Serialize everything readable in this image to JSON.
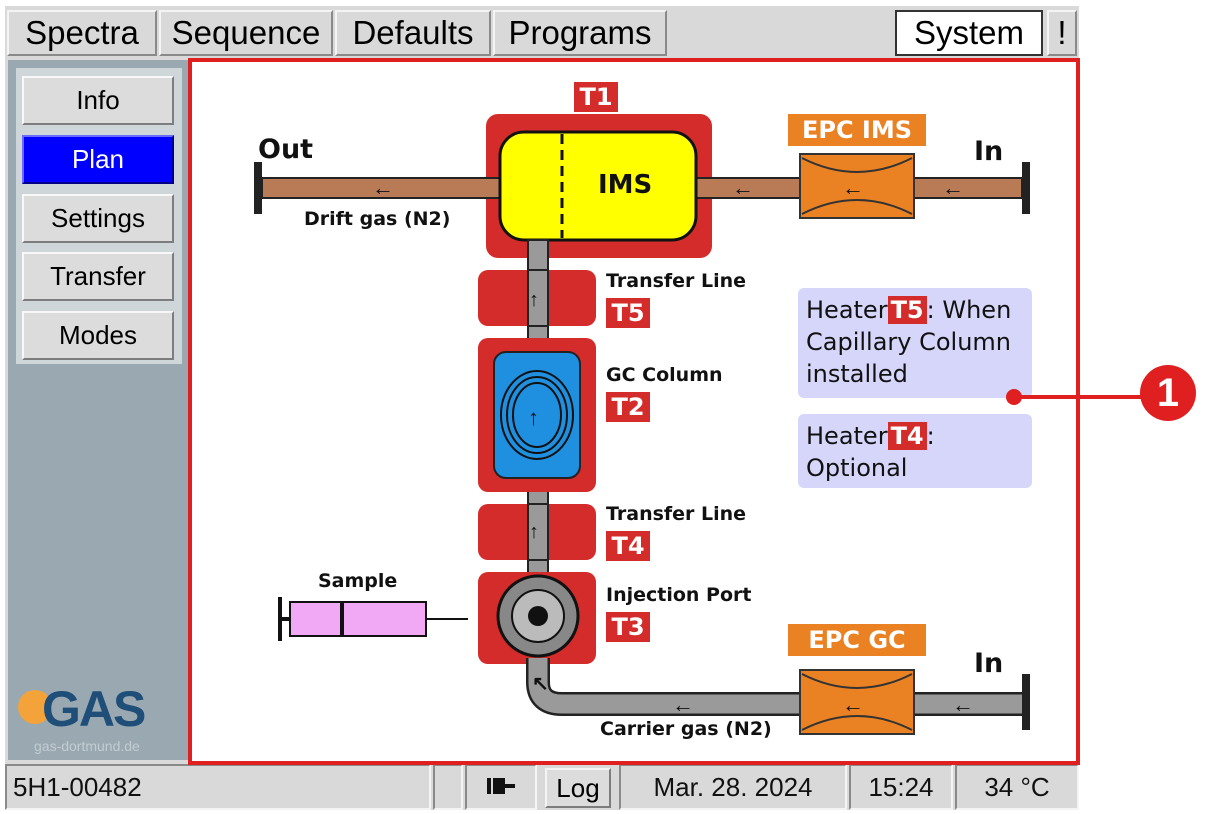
{
  "tabs": [
    {
      "label": "Spectra"
    },
    {
      "label": "Sequence"
    },
    {
      "label": "Defaults"
    },
    {
      "label": "Programs"
    }
  ],
  "system_label": "System",
  "alert_label": "!",
  "sidebar": {
    "items": [
      {
        "label": "Info"
      },
      {
        "label": "Plan"
      },
      {
        "label": "Settings"
      },
      {
        "label": "Transfer"
      },
      {
        "label": "Modes"
      }
    ],
    "active": "Plan",
    "logo_text": "GAS",
    "logo_url": "gas-dortmund.de"
  },
  "diagram": {
    "t1": "T1",
    "ims": "IMS",
    "epc_ims": "EPC IMS",
    "out": "Out",
    "in_top": "In",
    "drift_gas": "Drift gas (N2)",
    "transfer_line_top": "Transfer Line",
    "t5": "T5",
    "gc_column": "GC Column",
    "t2": "T2",
    "transfer_line_bottom": "Transfer Line",
    "t4": "T4",
    "sample": "Sample",
    "injection_port": "Injection Port",
    "t3": "T3",
    "epc_gc": "EPC GC",
    "in_bottom": "In",
    "carrier_gas": "Carrier gas (N2)",
    "note1": {
      "pre": "Heater",
      "tag": "T5",
      "post": ": When Capillary Column installed"
    },
    "note2": {
      "pre": "Heater",
      "tag": "T4",
      "post": ": Optional"
    }
  },
  "callout": "1",
  "status": {
    "device_id": "5H1-00482",
    "log_label": "Log",
    "date": "Mar. 28. 2024",
    "time": "15:24",
    "temperature": "34 °C"
  },
  "colors": {
    "active_tab": "#0000ff",
    "heater": "#d42b2b",
    "epc": "#ea8224",
    "ims": "#ffff00",
    "gc_column": "#1f8fe0",
    "sample": "#f2a9f5",
    "callout": "#e02020"
  }
}
